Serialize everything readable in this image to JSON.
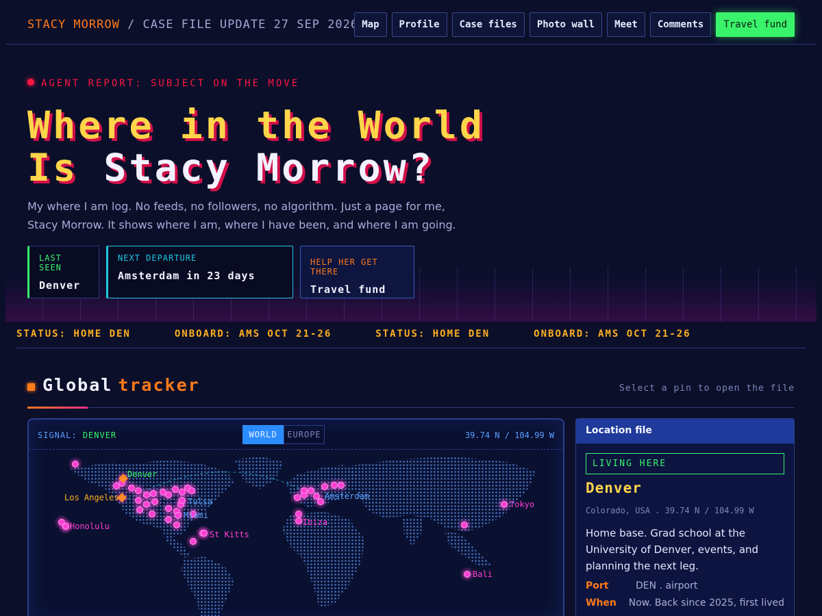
{
  "header": {
    "name": "STACY MORROW",
    "separator": " / ",
    "subtitle": "CASE FILE UPDATE 27 SEP 2026",
    "nav": [
      {
        "label": "Map"
      },
      {
        "label": "Profile"
      },
      {
        "label": "Case files"
      },
      {
        "label": "Photo wall"
      },
      {
        "label": "Meet"
      },
      {
        "label": "Comments"
      },
      {
        "label": "Travel fund"
      }
    ]
  },
  "hero": {
    "alert": "AGENT REPORT: SUBJECT ON THE MOVE",
    "title_line1": "Where in the World",
    "title_line2_a": "Is ",
    "title_line2_b": "Stacy Morrow?",
    "intro": "My where I am log. No feeds, no followers, no algorithm. Just a page for me, Stacy Morrow. It shows where I am, where I have been, and where I am going.",
    "cards": {
      "last_seen_label": "LAST SEEN",
      "last_seen_value": "Denver",
      "next_label": "NEXT DEPARTURE",
      "next_value": "Amsterdam in 23 days",
      "help_label": "HELP HER GET THERE",
      "help_value": "Travel fund"
    }
  },
  "ticker": [
    "STATUS: HOME DEN",
    "ONBOARD: AMS OCT 21-26",
    "STATUS: HOME DEN",
    "ONBOARD: AMS OCT 21-26"
  ],
  "tracker": {
    "title_a": "Global",
    "title_b": "tracker",
    "hint": "Select a pin to open the file",
    "signal_label": "SIGNAL:",
    "signal_value": "DENVER",
    "views": [
      "WORLD",
      "EUROPE"
    ],
    "active_view": "WORLD",
    "coords": "39.74 N / 104.99 W",
    "pin_labels": [
      "Denver",
      "Los Angeles",
      "Tulsa",
      "Miami",
      "Honolulu",
      "St Kitts",
      "Amsterdam",
      "Ibiza",
      "Tokyo",
      "Bali"
    ]
  },
  "location_file": {
    "header": "Location file",
    "tag": "LIVING HERE",
    "city": "Denver",
    "sub": "Colorado, USA . 39.74 N / 104.99 W",
    "desc": "Home base. Grad school at the University of Denver, events, and planning the next leg.",
    "rows": [
      {
        "k": "Port",
        "v": "DEN . airport"
      },
      {
        "k": "When",
        "v": "Now. Back since 2025, first lived"
      }
    ]
  },
  "colors": {
    "bg": "#0b0f2a",
    "accent_orange": "#ff7a1a",
    "accent_green": "#39f36a",
    "accent_yellow": "#ffd54a",
    "accent_pink": "#ff2e8a",
    "accent_cyan": "#1ec8e0"
  }
}
